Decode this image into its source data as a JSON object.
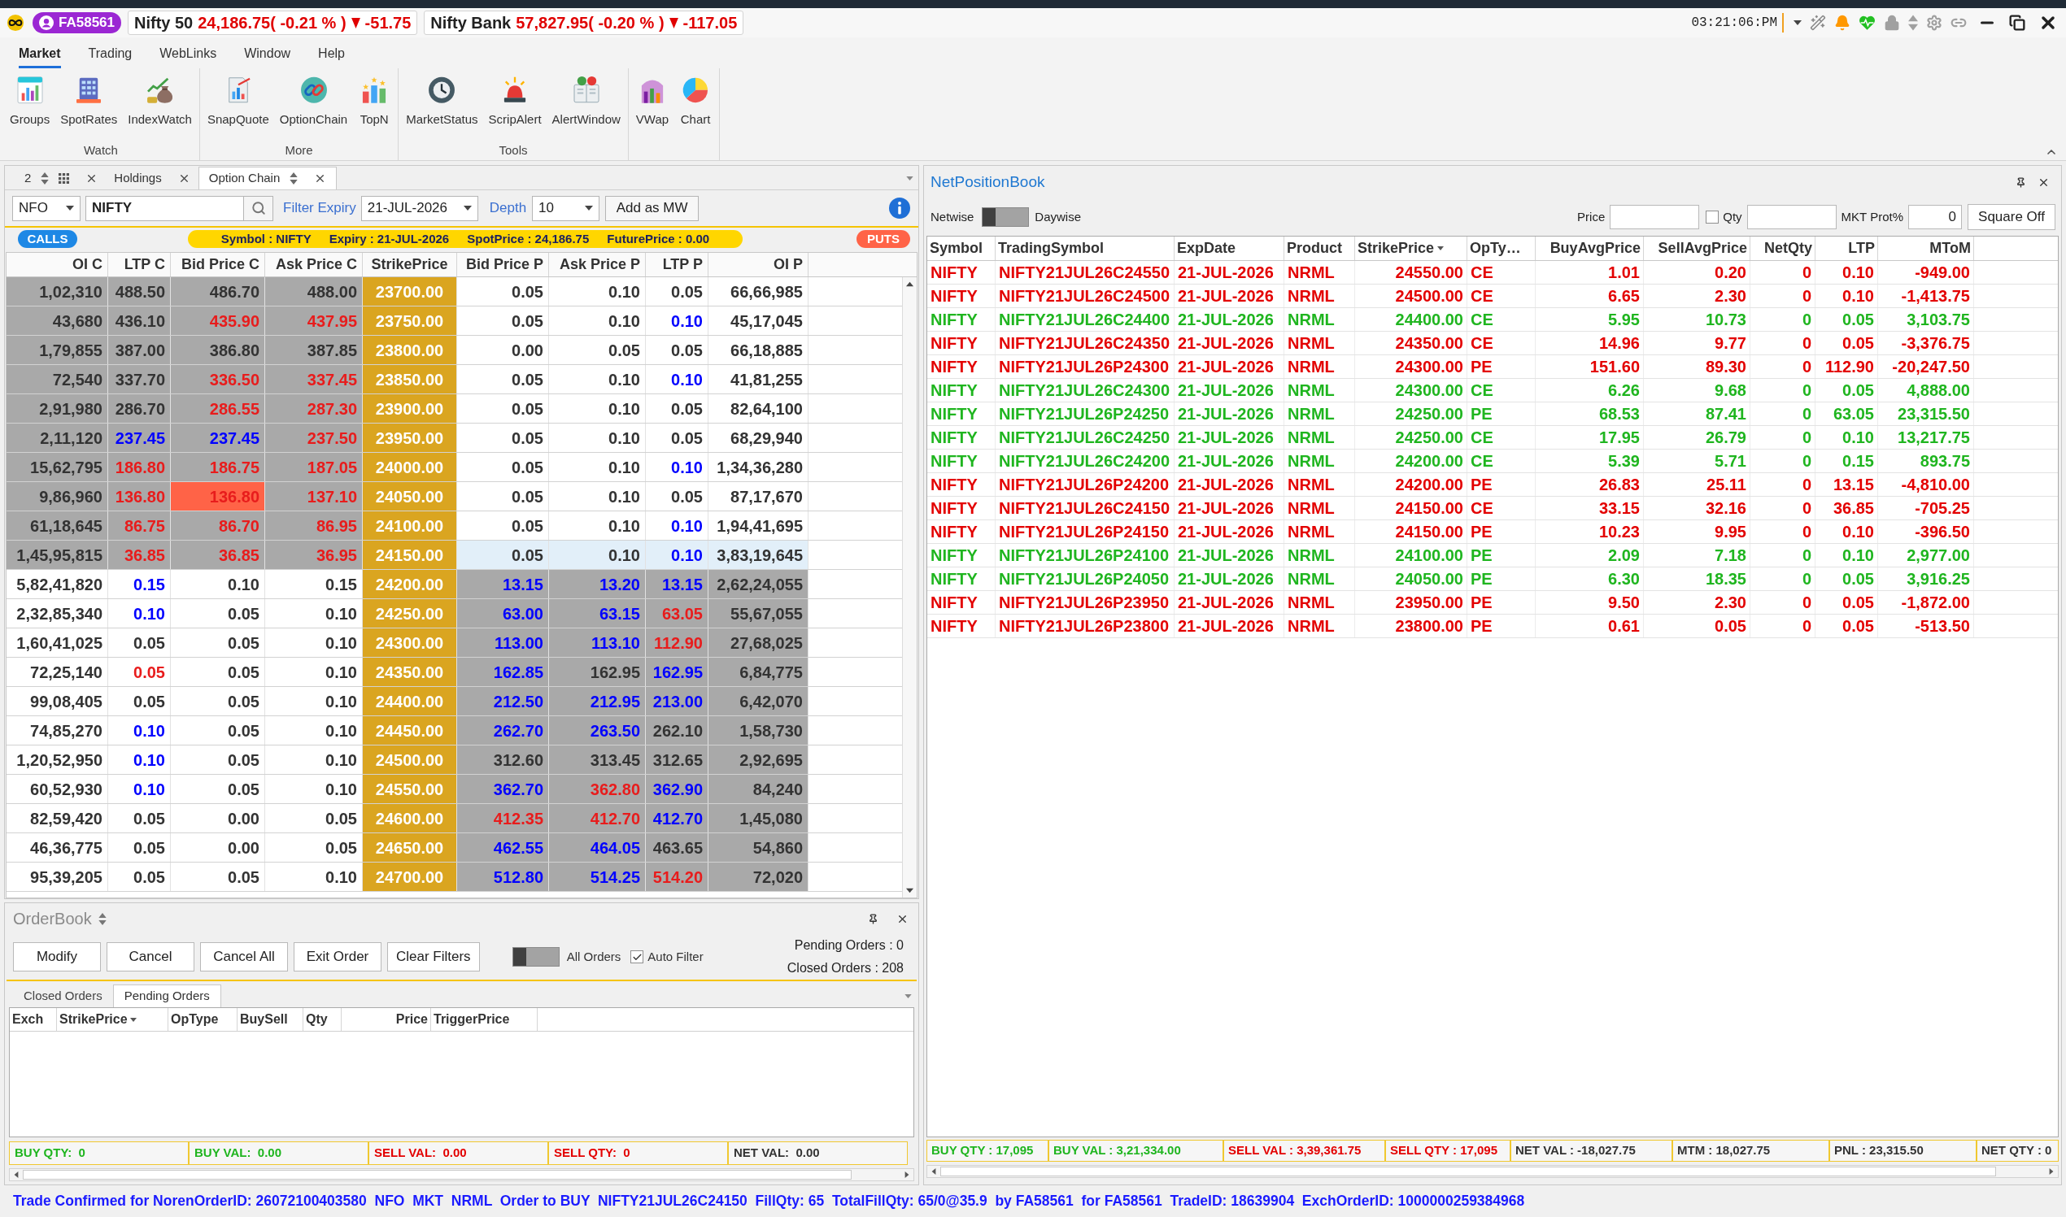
{
  "title_bar": {
    "user": "FA58561",
    "tickers": [
      {
        "name": "Nifty 50",
        "value": "24,186.75( -0.21 % )",
        "down": true,
        "change": "-51.75"
      },
      {
        "name": "Nifty Bank",
        "value": "57,827.95( -0.20 % )",
        "down": true,
        "change": "-117.05"
      }
    ],
    "time": "03:21:06:PM"
  },
  "menu": [
    {
      "label": "Market",
      "selected": true
    },
    {
      "label": "Trading",
      "selected": false
    },
    {
      "label": "WebLinks",
      "selected": false
    },
    {
      "label": "Window",
      "selected": false
    },
    {
      "label": "Help",
      "selected": false
    }
  ],
  "ribbon": [
    {
      "label": "Watch",
      "items": [
        "Groups",
        "SpotRates",
        "IndexWatch"
      ]
    },
    {
      "label": "More",
      "items": [
        "SnapQuote",
        "OptionChain",
        "TopN"
      ]
    },
    {
      "label": "Tools",
      "items": [
        "MarketStatus",
        "ScripAlert",
        "AlertWindow"
      ]
    },
    {
      "items": [
        "VWap",
        "Chart"
      ]
    }
  ],
  "option_chain": {
    "tabs": [
      {
        "label": "2",
        "kind": "watchlist",
        "selected": false
      },
      {
        "label": "Holdings",
        "kind": "plain",
        "selected": false
      },
      {
        "label": "Option Chain",
        "kind": "plain",
        "selected": true
      }
    ],
    "exchange": "NFO",
    "symbol": "NIFTY",
    "expiry_label": "Filter Expiry",
    "expiry": "21-JUL-2026",
    "depth_label": "Depth",
    "depth": "10",
    "add_button": "Add as MW",
    "calls": "CALLS",
    "puts": "PUTS",
    "banner": [
      "Symbol : NIFTY",
      "Expiry : 21-JUL-2026",
      "SpotPrice : 24,186.75",
      "FuturePrice : 0.00"
    ],
    "columns": [
      "OI C",
      "LTP C",
      "Bid Price C",
      "Ask Price C",
      "StrikePrice",
      "Bid Price P",
      "Ask Price P",
      "LTP P",
      "OI P"
    ],
    "rows": [
      {
        "strike": "23700.00",
        "call_itm": true,
        "selected": false,
        "calls": [
          {
            "text": "1,02,310"
          },
          {
            "text": "488.50"
          },
          {
            "text": "486.70"
          },
          {
            "text": "488.00"
          }
        ],
        "puts": [
          {
            "text": "0.05"
          },
          {
            "text": "0.10"
          },
          {
            "text": "0.05"
          },
          {
            "text": "66,66,985"
          }
        ]
      },
      {
        "strike": "23750.00",
        "call_itm": true,
        "selected": false,
        "calls": [
          {
            "text": "43,680"
          },
          {
            "text": "436.10"
          },
          {
            "text": "435.90",
            "color": "#e81c1c"
          },
          {
            "text": "437.95",
            "color": "#e81c1c"
          }
        ],
        "puts": [
          {
            "text": "0.05"
          },
          {
            "text": "0.10"
          },
          {
            "text": "0.10",
            "color": "#0000ff"
          },
          {
            "text": "45,17,045"
          }
        ]
      },
      {
        "strike": "23800.00",
        "call_itm": true,
        "selected": false,
        "calls": [
          {
            "text": "1,79,855"
          },
          {
            "text": "387.00"
          },
          {
            "text": "386.80"
          },
          {
            "text": "387.85"
          }
        ],
        "puts": [
          {
            "text": "0.00"
          },
          {
            "text": "0.05"
          },
          {
            "text": "0.05"
          },
          {
            "text": "66,18,885"
          }
        ]
      },
      {
        "strike": "23850.00",
        "call_itm": true,
        "selected": false,
        "calls": [
          {
            "text": "72,540"
          },
          {
            "text": "337.70"
          },
          {
            "text": "336.50",
            "color": "#e81c1c"
          },
          {
            "text": "337.45",
            "color": "#e81c1c"
          }
        ],
        "puts": [
          {
            "text": "0.05"
          },
          {
            "text": "0.10"
          },
          {
            "text": "0.10",
            "color": "#0000ff"
          },
          {
            "text": "41,81,255"
          }
        ]
      },
      {
        "strike": "23900.00",
        "call_itm": true,
        "selected": false,
        "calls": [
          {
            "text": "2,91,980"
          },
          {
            "text": "286.70"
          },
          {
            "text": "286.55",
            "color": "#e81c1c"
          },
          {
            "text": "287.30",
            "color": "#e81c1c"
          }
        ],
        "puts": [
          {
            "text": "0.05"
          },
          {
            "text": "0.10"
          },
          {
            "text": "0.05"
          },
          {
            "text": "82,64,100"
          }
        ]
      },
      {
        "strike": "23950.00",
        "call_itm": true,
        "selected": false,
        "calls": [
          {
            "text": "2,11,120"
          },
          {
            "text": "237.45",
            "color": "#0000ff"
          },
          {
            "text": "237.45",
            "color": "#0000ff"
          },
          {
            "text": "237.50",
            "color": "#e81c1c"
          }
        ],
        "puts": [
          {
            "text": "0.05"
          },
          {
            "text": "0.10"
          },
          {
            "text": "0.05"
          },
          {
            "text": "68,29,940"
          }
        ]
      },
      {
        "strike": "24000.00",
        "call_itm": true,
        "selected": false,
        "calls": [
          {
            "text": "15,62,795"
          },
          {
            "text": "186.80",
            "color": "#e81c1c"
          },
          {
            "text": "186.75",
            "color": "#e81c1c"
          },
          {
            "text": "187.05",
            "color": "#e81c1c"
          }
        ],
        "puts": [
          {
            "text": "0.05"
          },
          {
            "text": "0.10"
          },
          {
            "text": "0.10",
            "color": "#0000ff"
          },
          {
            "text": "1,34,36,280"
          }
        ]
      },
      {
        "strike": "24050.00",
        "call_itm": true,
        "selected": false,
        "calls": [
          {
            "text": "9,86,960"
          },
          {
            "text": "136.80",
            "color": "#e81c1c"
          },
          {
            "text": "136.80",
            "color": "#e81c1c",
            "flash": true
          },
          {
            "text": "137.10",
            "color": "#e81c1c"
          }
        ],
        "puts": [
          {
            "text": "0.05"
          },
          {
            "text": "0.10"
          },
          {
            "text": "0.05"
          },
          {
            "text": "87,17,670"
          }
        ]
      },
      {
        "strike": "24100.00",
        "call_itm": true,
        "selected": false,
        "calls": [
          {
            "text": "61,18,645"
          },
          {
            "text": "86.75",
            "color": "#e81c1c"
          },
          {
            "text": "86.70",
            "color": "#e81c1c"
          },
          {
            "text": "86.95",
            "color": "#e81c1c"
          }
        ],
        "puts": [
          {
            "text": "0.05"
          },
          {
            "text": "0.10"
          },
          {
            "text": "0.10",
            "color": "#0000ff"
          },
          {
            "text": "1,94,41,695"
          }
        ]
      },
      {
        "strike": "24150.00",
        "call_itm": true,
        "selected": true,
        "calls": [
          {
            "text": "1,45,95,815"
          },
          {
            "text": "36.85",
            "color": "#e81c1c"
          },
          {
            "text": "36.85",
            "color": "#e81c1c"
          },
          {
            "text": "36.95",
            "color": "#e81c1c"
          }
        ],
        "puts": [
          {
            "text": "0.05"
          },
          {
            "text": "0.10"
          },
          {
            "text": "0.10",
            "color": "#0000ff"
          },
          {
            "text": "3,83,19,645"
          }
        ]
      },
      {
        "strike": "24200.00",
        "call_itm": false,
        "selected": false,
        "calls": [
          {
            "text": "5,82,41,820"
          },
          {
            "text": "0.15",
            "color": "#0000ff"
          },
          {
            "text": "0.10"
          },
          {
            "text": "0.15"
          }
        ],
        "puts": [
          {
            "text": "13.15",
            "color": "#0000ff"
          },
          {
            "text": "13.20",
            "color": "#0000ff"
          },
          {
            "text": "13.15",
            "color": "#0000ff"
          },
          {
            "text": "2,62,24,055"
          }
        ]
      },
      {
        "strike": "24250.00",
        "call_itm": false,
        "selected": false,
        "calls": [
          {
            "text": "2,32,85,340"
          },
          {
            "text": "0.10",
            "color": "#0000ff"
          },
          {
            "text": "0.05"
          },
          {
            "text": "0.10"
          }
        ],
        "puts": [
          {
            "text": "63.00",
            "color": "#0000ff"
          },
          {
            "text": "63.15",
            "color": "#0000ff"
          },
          {
            "text": "63.05",
            "color": "#e81c1c"
          },
          {
            "text": "55,67,055"
          }
        ]
      },
      {
        "strike": "24300.00",
        "call_itm": false,
        "selected": false,
        "calls": [
          {
            "text": "1,60,41,025"
          },
          {
            "text": "0.05"
          },
          {
            "text": "0.05"
          },
          {
            "text": "0.10"
          }
        ],
        "puts": [
          {
            "text": "113.00",
            "color": "#0000ff"
          },
          {
            "text": "113.10",
            "color": "#0000ff"
          },
          {
            "text": "112.90",
            "color": "#e81c1c"
          },
          {
            "text": "27,68,025"
          }
        ]
      },
      {
        "strike": "24350.00",
        "call_itm": false,
        "selected": false,
        "calls": [
          {
            "text": "72,25,140"
          },
          {
            "text": "0.05",
            "color": "#e81c1c"
          },
          {
            "text": "0.05"
          },
          {
            "text": "0.10"
          }
        ],
        "puts": [
          {
            "text": "162.85",
            "color": "#0000ff"
          },
          {
            "text": "162.95"
          },
          {
            "text": "162.95",
            "color": "#0000ff"
          },
          {
            "text": "6,84,775"
          }
        ]
      },
      {
        "strike": "24400.00",
        "call_itm": false,
        "selected": false,
        "calls": [
          {
            "text": "99,08,405"
          },
          {
            "text": "0.05"
          },
          {
            "text": "0.05"
          },
          {
            "text": "0.10"
          }
        ],
        "puts": [
          {
            "text": "212.50",
            "color": "#0000ff"
          },
          {
            "text": "212.95",
            "color": "#0000ff"
          },
          {
            "text": "213.00",
            "color": "#0000ff"
          },
          {
            "text": "6,42,070"
          }
        ]
      },
      {
        "strike": "24450.00",
        "call_itm": false,
        "selected": false,
        "calls": [
          {
            "text": "74,85,270"
          },
          {
            "text": "0.10",
            "color": "#0000ff"
          },
          {
            "text": "0.05"
          },
          {
            "text": "0.10"
          }
        ],
        "puts": [
          {
            "text": "262.70",
            "color": "#0000ff"
          },
          {
            "text": "263.50",
            "color": "#0000ff"
          },
          {
            "text": "262.10"
          },
          {
            "text": "1,58,730"
          }
        ]
      },
      {
        "strike": "24500.00",
        "call_itm": false,
        "selected": false,
        "calls": [
          {
            "text": "1,20,52,950"
          },
          {
            "text": "0.10",
            "color": "#0000ff"
          },
          {
            "text": "0.05"
          },
          {
            "text": "0.10"
          }
        ],
        "puts": [
          {
            "text": "312.60"
          },
          {
            "text": "313.45"
          },
          {
            "text": "312.65"
          },
          {
            "text": "2,92,695"
          }
        ]
      },
      {
        "strike": "24550.00",
        "call_itm": false,
        "selected": false,
        "calls": [
          {
            "text": "60,52,930"
          },
          {
            "text": "0.10",
            "color": "#0000ff"
          },
          {
            "text": "0.05"
          },
          {
            "text": "0.10"
          }
        ],
        "puts": [
          {
            "text": "362.70",
            "color": "#0000ff"
          },
          {
            "text": "362.80",
            "color": "#e81c1c"
          },
          {
            "text": "362.90",
            "color": "#0000ff"
          },
          {
            "text": "84,240"
          }
        ]
      },
      {
        "strike": "24600.00",
        "call_itm": false,
        "selected": false,
        "calls": [
          {
            "text": "82,59,420"
          },
          {
            "text": "0.05"
          },
          {
            "text": "0.00"
          },
          {
            "text": "0.05"
          }
        ],
        "puts": [
          {
            "text": "412.35",
            "color": "#e81c1c"
          },
          {
            "text": "412.70",
            "color": "#e81c1c"
          },
          {
            "text": "412.70",
            "color": "#0000ff"
          },
          {
            "text": "1,45,080"
          }
        ]
      },
      {
        "strike": "24650.00",
        "call_itm": false,
        "selected": false,
        "calls": [
          {
            "text": "46,36,775"
          },
          {
            "text": "0.05"
          },
          {
            "text": "0.00"
          },
          {
            "text": "0.05"
          }
        ],
        "puts": [
          {
            "text": "462.55",
            "color": "#0000ff"
          },
          {
            "text": "464.05",
            "color": "#0000ff"
          },
          {
            "text": "463.65"
          },
          {
            "text": "54,860"
          }
        ]
      },
      {
        "strike": "24700.00",
        "call_itm": false,
        "selected": false,
        "calls": [
          {
            "text": "95,39,205"
          },
          {
            "text": "0.05"
          },
          {
            "text": "0.05"
          },
          {
            "text": "0.10"
          }
        ],
        "puts": [
          {
            "text": "512.80",
            "color": "#0000ff"
          },
          {
            "text": "514.25",
            "color": "#0000ff"
          },
          {
            "text": "514.20",
            "color": "#e81c1c"
          },
          {
            "text": "72,020"
          }
        ]
      }
    ]
  },
  "order_book": {
    "title": "OrderBook",
    "buttons": [
      "Modify",
      "Cancel",
      "Cancel All",
      "Exit Order",
      "Clear Filters"
    ],
    "all_orders": {
      "label": "All Orders",
      "on": false
    },
    "auto_filter": {
      "label": "Auto Filter",
      "checked": true
    },
    "counts": [
      "Pending Orders : 0",
      "Closed Orders : 208"
    ],
    "tabs": [
      {
        "label": "Closed Orders",
        "selected": false
      },
      {
        "label": "Pending Orders",
        "selected": true
      }
    ],
    "columns": [
      {
        "label": "Exch",
        "sorted": false
      },
      {
        "label": "StrikePrice",
        "sorted": true
      },
      {
        "label": "OpType",
        "sorted": false
      },
      {
        "label": "BuySell",
        "sorted": false
      },
      {
        "label": "Qty",
        "sorted": false
      },
      {
        "label": "Price",
        "sorted": false
      },
      {
        "label": "TriggerPrice",
        "sorted": false
      }
    ],
    "summary": [
      {
        "text": "BUY QTY:  0",
        "color": "#1fb51f"
      },
      {
        "text": "BUY VAL:  0.00",
        "color": "#1fb51f"
      },
      {
        "text": "SELL VAL:  0.00",
        "color": "#e30000"
      },
      {
        "text": "SELL QTY:  0",
        "color": "#e30000"
      },
      {
        "text": "NET VAL:  0.00",
        "color": "#333333"
      }
    ]
  },
  "net_position_book": {
    "title": "NetPositionBook",
    "netwise": "Netwise",
    "daywise": "Daywise",
    "daywise_on": false,
    "price_label": "Price",
    "qty_label": "Qty",
    "qty_checked": false,
    "mkt_prot_label": "MKT Prot%",
    "mkt_prot": "0",
    "square_off": "Square Off",
    "columns": [
      {
        "label": "Symbol",
        "sorted": false
      },
      {
        "label": "TradingSymbol",
        "sorted": false
      },
      {
        "label": "ExpDate",
        "sorted": false
      },
      {
        "label": "Product",
        "sorted": false
      },
      {
        "label": "StrikePrice",
        "sorted": true
      },
      {
        "label": "OpTy…",
        "sorted": false
      },
      {
        "label": "BuyAvgPrice",
        "sorted": false
      },
      {
        "label": "SellAvgPrice",
        "sorted": false
      },
      {
        "label": "NetQty",
        "sorted": false
      },
      {
        "label": "LTP",
        "sorted": false
      },
      {
        "label": "MToM",
        "sorted": false
      }
    ],
    "rows": [
      {
        "color": "#e30000",
        "cells": [
          "NIFTY",
          "NIFTY21JUL26C24550",
          "21-JUL-2026",
          "NRML",
          "24550.00",
          "CE",
          "1.01",
          "0.20",
          "0",
          "0.10",
          "-949.00"
        ]
      },
      {
        "color": "#e30000",
        "cells": [
          "NIFTY",
          "NIFTY21JUL26C24500",
          "21-JUL-2026",
          "NRML",
          "24500.00",
          "CE",
          "6.65",
          "2.30",
          "0",
          "0.10",
          "-1,413.75"
        ]
      },
      {
        "color": "#1fb51f",
        "cells": [
          "NIFTY",
          "NIFTY21JUL26C24400",
          "21-JUL-2026",
          "NRML",
          "24400.00",
          "CE",
          "5.95",
          "10.73",
          "0",
          "0.05",
          "3,103.75"
        ]
      },
      {
        "color": "#e30000",
        "cells": [
          "NIFTY",
          "NIFTY21JUL26C24350",
          "21-JUL-2026",
          "NRML",
          "24350.00",
          "CE",
          "14.96",
          "9.77",
          "0",
          "0.05",
          "-3,376.75"
        ]
      },
      {
        "color": "#e30000",
        "cells": [
          "NIFTY",
          "NIFTY21JUL26P24300",
          "21-JUL-2026",
          "NRML",
          "24300.00",
          "PE",
          "151.60",
          "89.30",
          "0",
          "112.90",
          "-20,247.50"
        ]
      },
      {
        "color": "#1fb51f",
        "cells": [
          "NIFTY",
          "NIFTY21JUL26C24300",
          "21-JUL-2026",
          "NRML",
          "24300.00",
          "CE",
          "6.26",
          "9.68",
          "0",
          "0.05",
          "4,888.00"
        ]
      },
      {
        "color": "#1fb51f",
        "cells": [
          "NIFTY",
          "NIFTY21JUL26P24250",
          "21-JUL-2026",
          "NRML",
          "24250.00",
          "PE",
          "68.53",
          "87.41",
          "0",
          "63.05",
          "23,315.50"
        ]
      },
      {
        "color": "#1fb51f",
        "cells": [
          "NIFTY",
          "NIFTY21JUL26C24250",
          "21-JUL-2026",
          "NRML",
          "24250.00",
          "CE",
          "17.95",
          "26.79",
          "0",
          "0.10",
          "13,217.75"
        ]
      },
      {
        "color": "#1fb51f",
        "cells": [
          "NIFTY",
          "NIFTY21JUL26C24200",
          "21-JUL-2026",
          "NRML",
          "24200.00",
          "CE",
          "5.39",
          "5.71",
          "0",
          "0.15",
          "893.75"
        ]
      },
      {
        "color": "#e30000",
        "cells": [
          "NIFTY",
          "NIFTY21JUL26P24200",
          "21-JUL-2026",
          "NRML",
          "24200.00",
          "PE",
          "26.83",
          "25.11",
          "0",
          "13.15",
          "-4,810.00"
        ]
      },
      {
        "color": "#e30000",
        "cells": [
          "NIFTY",
          "NIFTY21JUL26C24150",
          "21-JUL-2026",
          "NRML",
          "24150.00",
          "CE",
          "33.15",
          "32.16",
          "0",
          "36.85",
          "-705.25"
        ]
      },
      {
        "color": "#e30000",
        "cells": [
          "NIFTY",
          "NIFTY21JUL26P24150",
          "21-JUL-2026",
          "NRML",
          "24150.00",
          "PE",
          "10.23",
          "9.95",
          "0",
          "0.10",
          "-396.50"
        ]
      },
      {
        "color": "#1fb51f",
        "cells": [
          "NIFTY",
          "NIFTY21JUL26P24100",
          "21-JUL-2026",
          "NRML",
          "24100.00",
          "PE",
          "2.09",
          "7.18",
          "0",
          "0.10",
          "2,977.00"
        ]
      },
      {
        "color": "#1fb51f",
        "cells": [
          "NIFTY",
          "NIFTY21JUL26P24050",
          "21-JUL-2026",
          "NRML",
          "24050.00",
          "PE",
          "6.30",
          "18.35",
          "0",
          "0.05",
          "3,916.25"
        ]
      },
      {
        "color": "#e30000",
        "cells": [
          "NIFTY",
          "NIFTY21JUL26P23950",
          "21-JUL-2026",
          "NRML",
          "23950.00",
          "PE",
          "9.50",
          "2.30",
          "0",
          "0.05",
          "-1,872.00"
        ]
      },
      {
        "color": "#e30000",
        "cells": [
          "NIFTY",
          "NIFTY21JUL26P23800",
          "21-JUL-2026",
          "NRML",
          "23800.00",
          "PE",
          "0.61",
          "0.05",
          "0",
          "0.05",
          "-513.50"
        ]
      }
    ],
    "summary": [
      {
        "text": "BUY QTY : 17,095",
        "color": "#1fb51f"
      },
      {
        "text": "BUY VAL : 3,21,334.00",
        "color": "#1fb51f"
      },
      {
        "text": "SELL VAL : 3,39,361.75",
        "color": "#e30000"
      },
      {
        "text": "SELL QTY : 17,095",
        "color": "#e30000"
      },
      {
        "text": "NET VAL : -18,027.75",
        "color": "#333333"
      },
      {
        "text": "MTM : 18,027.75",
        "color": "#333333"
      },
      {
        "text": "PNL : 23,315.50",
        "color": "#333333"
      },
      {
        "text": "NET QTY : 0",
        "color": "#333333"
      }
    ]
  },
  "status_message": "Trade Confirmed for NorenOrderID: 26072100403580  NFO  MKT  NRML  Order to BUY  NIFTY21JUL26C24150  FillQty: 65  TotalFillQty: 65/0@35.9  by FA58561  for FA58561  TradeID: 18639904  ExchOrderID: 1000000259384968"
}
